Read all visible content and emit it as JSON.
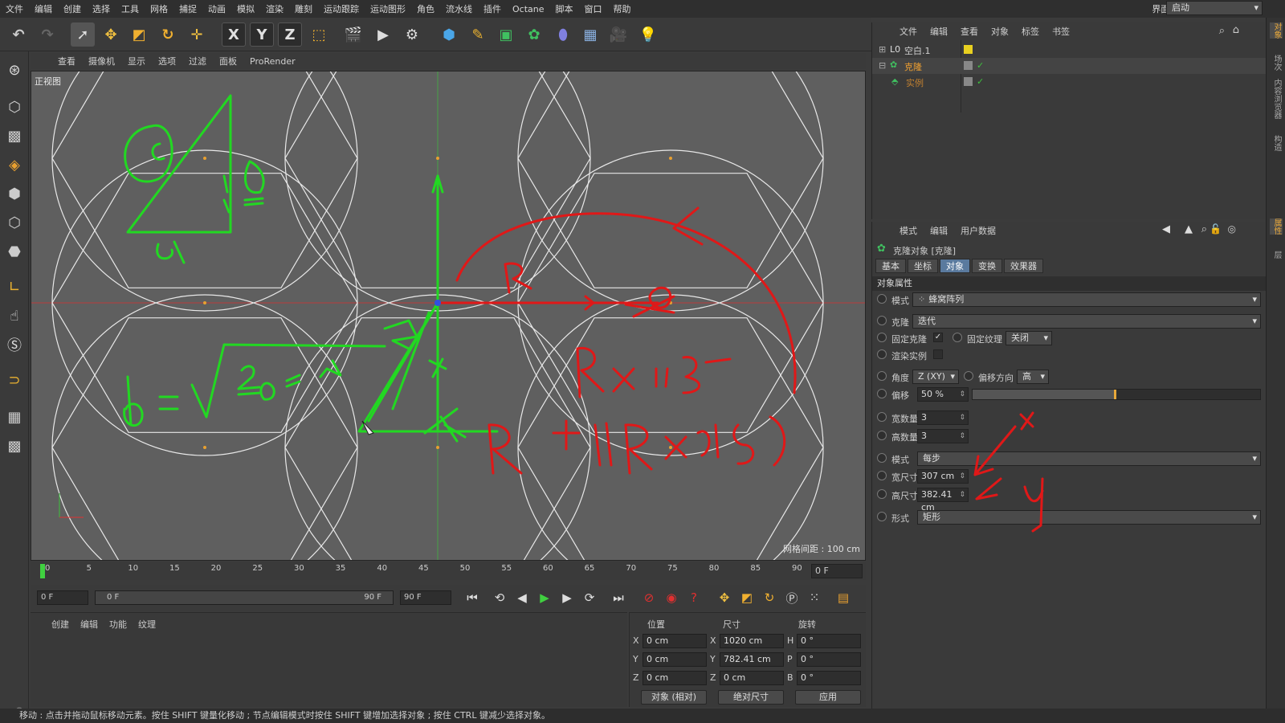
{
  "menubar": {
    "items": [
      "文件",
      "编辑",
      "创建",
      "选择",
      "工具",
      "网格",
      "捕捉",
      "动画",
      "模拟",
      "渲染",
      "雕刻",
      "运动跟踪",
      "运动图形",
      "角色",
      "流水线",
      "插件",
      "Octane",
      "脚本",
      "窗口",
      "帮助"
    ],
    "layout_label": "界面:",
    "layout_value": "启动"
  },
  "toolbar": {
    "axis_x": "X",
    "axis_y": "Y",
    "axis_z": "Z",
    "icons": [
      "undo-icon",
      "redo-icon",
      "select-icon",
      "move-icon",
      "scale-icon",
      "rotate-icon",
      "live-selection-icon",
      "x-axis-icon",
      "y-axis-icon",
      "z-axis-icon",
      "coordinate-system-icon",
      "render-view-icon",
      "render-picture-viewer-icon",
      "edit-render-settings-icon",
      "cube-icon",
      "pen-icon",
      "subdivision-icon",
      "cloner-icon",
      "deformer-icon",
      "floor-icon",
      "camera-icon",
      "light-icon"
    ]
  },
  "viewport": {
    "menu": [
      "查看",
      "摄像机",
      "显示",
      "选项",
      "过滤",
      "面板",
      "ProRender"
    ],
    "name": "正视图",
    "grid_spacing": "网格间距 : 100 cm"
  },
  "timeline": {
    "ticks": [
      "0",
      "5",
      "10",
      "15",
      "20",
      "25",
      "30",
      "35",
      "40",
      "45",
      "50",
      "55",
      "60",
      "65",
      "70",
      "75",
      "80",
      "85",
      "90"
    ],
    "current_frame": "0 F"
  },
  "transport": {
    "start_frame": "0 F",
    "range_start": "0 F",
    "range_end": "90 F",
    "end_frame": "90 F"
  },
  "material_manager": {
    "menu": [
      "创建",
      "编辑",
      "功能",
      "纹理"
    ]
  },
  "coordinates": {
    "headers": {
      "position": "位置",
      "size": "尺寸",
      "rotation": "旋转"
    },
    "rows": [
      {
        "axis": "X",
        "pos": "0 cm",
        "size_axis": "X",
        "size": "1020 cm",
        "rot_axis": "H",
        "rot": "0 °"
      },
      {
        "axis": "Y",
        "pos": "0 cm",
        "size_axis": "Y",
        "size": "782.41 cm",
        "rot_axis": "P",
        "rot": "0 °"
      },
      {
        "axis": "Z",
        "pos": "0 cm",
        "size_axis": "Z",
        "size": "0 cm",
        "rot_axis": "B",
        "rot": "0 °"
      }
    ],
    "mode1": "对象 (相对)",
    "mode2": "绝对尺寸",
    "apply": "应用"
  },
  "status": {
    "text": "移动 : 点击并拖动鼠标移动元素。按住 SHIFT 键量化移动 ; 节点编辑模式时按住 SHIFT 键增加选择对象 ; 按住 CTRL 键减少选择对象。"
  },
  "object_manager": {
    "menu": [
      "文件",
      "编辑",
      "查看",
      "对象",
      "标签",
      "书签"
    ],
    "objects": [
      {
        "name": "空白.1",
        "color": "#d0d0d0",
        "tag_color": "#e8d020"
      },
      {
        "name": "克隆",
        "color": "#f0a030",
        "tag_color": "#888888"
      },
      {
        "name": "实例",
        "color": "#c08030",
        "tag_color": "#888888"
      }
    ]
  },
  "attributes": {
    "menu": [
      "模式",
      "编辑",
      "用户数据"
    ],
    "title": "克隆对象 [克隆]",
    "tabs": [
      "基本",
      "坐标",
      "对象",
      "变换",
      "效果器"
    ],
    "active_tab": "对象",
    "section": "对象属性",
    "mode_label": "模式",
    "mode_value": "蜂窝阵列",
    "clone_label": "克隆",
    "clone_value": "迭代",
    "fix_clone_label": "固定克隆",
    "fix_texture_label": "固定纹理",
    "fix_texture_value": "关闭",
    "render_instance_label": "渲染实例",
    "angle_label": "角度",
    "angle_value": "Z (XY)",
    "offset_dir_label": "偏移方向",
    "offset_dir_value": "高",
    "offset_label": "偏移",
    "offset_value": "50 %",
    "offset_fraction": 0.5,
    "width_count_label": "宽数量",
    "width_count_value": "3",
    "height_count_label": "高数量",
    "height_count_value": "3",
    "mode2_label": "模式",
    "mode2_value": "每步",
    "width_size_label": "宽尺寸",
    "width_size_value": "307 cm",
    "height_size_label": "高尺寸",
    "height_size_value": "382.41 cm",
    "form_label": "形式",
    "form_value": "矩形"
  },
  "right_strip": [
    "对象",
    "场次",
    "内容浏览器",
    "构造",
    "属性",
    "层"
  ],
  "colors": {
    "accent": "#e8a83a",
    "annotation_green": "#22d822",
    "annotation_red": "#e01818"
  }
}
